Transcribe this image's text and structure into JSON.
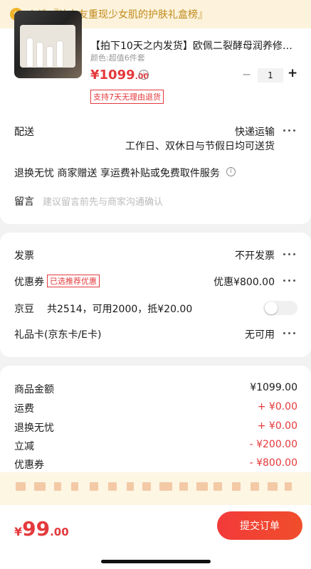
{
  "banner": {
    "text": "入选『让女友重现少女肌的护肤礼盒榜』",
    "icon": "trophy-icon"
  },
  "product": {
    "title": "【拍下10天之内发货】欧佩二裂酵母润养修…",
    "spec": "颜色:超值6件套",
    "price_int": "¥1099",
    "price_dec": ".00",
    "qty": "1",
    "return_tag": "支持7天无理由退货"
  },
  "delivery": {
    "label": "配送",
    "method": "快递运输",
    "time": "工作日、双休日与节假日均可送货"
  },
  "services": {
    "text": "退换无忧  商家赠送  享运费补贴或免费取件服务"
  },
  "message": {
    "label": "留言",
    "placeholder": "建议留言前先与商家沟通确认"
  },
  "invoice": {
    "label": "发票",
    "value": "不开发票"
  },
  "coupon": {
    "label": "优惠券",
    "tag": "已选推荐优惠",
    "value": "优惠¥800.00"
  },
  "jingdou": {
    "label": "京豆",
    "value": "共2514，可用2000，抵¥20.00"
  },
  "giftcard": {
    "label": "礼品卡(京东卡/E卡)",
    "value": "无可用"
  },
  "summary": [
    {
      "label": "商品金额",
      "value": "¥1099.00"
    },
    {
      "label": "运费",
      "value": "+ ¥0.00"
    },
    {
      "label": "退换无忧",
      "value": "+ ¥0.00"
    },
    {
      "label": "立减",
      "value": "- ¥200.00"
    },
    {
      "label": "优惠券",
      "value": "- ¥800.00"
    }
  ],
  "footer": {
    "currency": "¥",
    "total_int": "99",
    "total_dec": ".00",
    "submit": "提交订单"
  },
  "colors": {
    "accent": "#e4393c",
    "banner_bg": "#fdf3dc",
    "banner_text": "#c08a1a"
  }
}
